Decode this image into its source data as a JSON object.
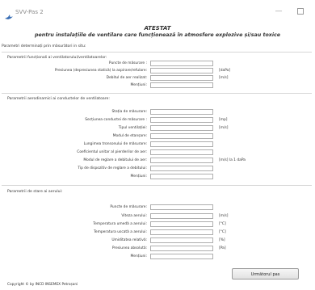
{
  "window": {
    "title": "SVV-Pas 2",
    "minimize_glyph": "—",
    "app_icon": "bird-icon"
  },
  "heading": {
    "line1": "ATESTAT",
    "line2": "pentru instalațiile de ventilare care funcționează în atmosfere explozive și/sau toxice"
  },
  "intro": "Parametri determinați prin măsurători in situ:",
  "sections": {
    "functional": {
      "title": "Parametrii funcționali ai ventilatorului/ventilatoarelor:",
      "fields": [
        {
          "label": "Puncte de măsurare :",
          "value": "",
          "unit": ""
        },
        {
          "label": "Presiunea (depresiunea statică) la aspirare/refulare:",
          "value": "",
          "unit": "[daPa]"
        },
        {
          "label": "Debitul de aer realizat:",
          "value": "",
          "unit": "[m/s]"
        },
        {
          "label": "Mențiuni:",
          "value": "",
          "unit": ""
        }
      ]
    },
    "aerodynamic": {
      "title": "Parametrii aerodinamici ai conductelor de ventilatoare:",
      "fields": [
        {
          "label": "Stația de măsurare:",
          "value": "",
          "unit": ""
        },
        {
          "label": "Secțiunea conductei de măsurare :",
          "value": "",
          "unit": "[mp]"
        },
        {
          "label": "Tipul ventilației:",
          "value": "",
          "unit": "[m/s]"
        },
        {
          "label": "Modul de etanșare:",
          "value": "",
          "unit": ""
        },
        {
          "label": "Lungimea tronsonului de măsurare:",
          "value": "",
          "unit": ""
        },
        {
          "label": "Coeficientul unitar al pierderilor de aer:",
          "value": "",
          "unit": ""
        },
        {
          "label": "Modul de reglare a debitului de aer:",
          "value": "",
          "unit": "[m/s] la 1 daPa"
        },
        {
          "label": "Tip de dispozitiv de reglare a debitului:",
          "value": "",
          "unit": ""
        },
        {
          "label": "Mențiuni:",
          "value": "",
          "unit": ""
        }
      ]
    },
    "air": {
      "title": "Parametrii de stare ai aerului:",
      "fields": [
        {
          "label": "Puncte de măsurare:",
          "value": "",
          "unit": ""
        },
        {
          "label": "Viteza aerului:",
          "value": "",
          "unit": "[m/s]"
        },
        {
          "label": "Temperatura umedă a aerului:",
          "value": "",
          "unit": "[°C]"
        },
        {
          "label": "Temperatura uscată a aerului:",
          "value": "",
          "unit": "[°C]"
        },
        {
          "label": "Umiditatea relativă:",
          "value": "",
          "unit": "[%]"
        },
        {
          "label": "Presiunea absolută:",
          "value": "",
          "unit": "[Pa]"
        },
        {
          "label": "Mențiuni:",
          "value": "",
          "unit": ""
        }
      ]
    }
  },
  "next_button": "Următorul pas",
  "copyright": "Copyright © by INCD INSEMEX Petroșani"
}
